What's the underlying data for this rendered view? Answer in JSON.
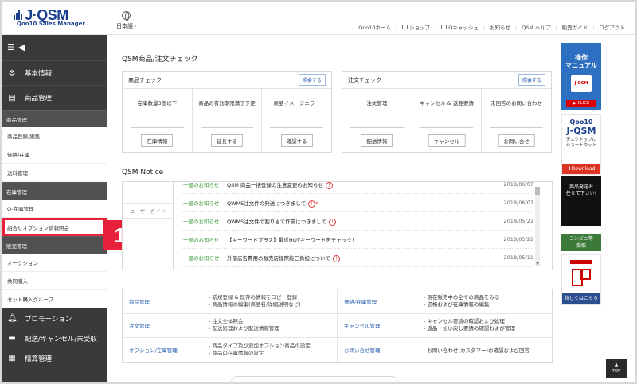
{
  "header": {
    "logo_text": "J·QSM",
    "logo_sub": "Qoo10 Sales Manager",
    "language": "日本語",
    "links": [
      "Qoo10ホーム",
      "ショップ",
      "Qキャッシュ",
      "お知らせ",
      "QSM ヘルプ",
      "販売ガイド",
      "ログアウト"
    ]
  },
  "sidebar": {
    "toggle": "☰ ◀",
    "top_items": [
      {
        "label": "基本情報",
        "icon": "gear-icon"
      },
      {
        "label": "商品管理",
        "icon": "document-icon"
      }
    ],
    "group1": "商品管理",
    "group1_items": [
      "商品登録/編集",
      "価格/在庫",
      "送料管理"
    ],
    "group2": "在庫管理",
    "group2_items": [
      "Q-在庫管理",
      "組合せオプション情報照会"
    ],
    "group3": "販売管理",
    "group3_items": [
      "オークション",
      "共同購入",
      "セット購入グループ"
    ],
    "bottom_items": [
      {
        "label": "プロモーション",
        "icon": "bell-icon"
      },
      {
        "label": "配送/キャンセル/未受取",
        "icon": "truck-icon"
      },
      {
        "label": "精算管理",
        "icon": "calculator-icon"
      }
    ]
  },
  "callout": "1",
  "main": {
    "title": "QSM商品/注文チェック",
    "product_check": {
      "title": "商品チェック",
      "reset": "照会する",
      "cols": [
        {
          "label": "在庫数量3個以下",
          "action": "在庫情報"
        },
        {
          "label": "商品の有効期限満了予定",
          "action": "延長する"
        },
        {
          "label": "商品イメージエラー",
          "action": "確認する"
        }
      ]
    },
    "order_check": {
      "title": "注文チェック",
      "reset": "照会する",
      "cols": [
        {
          "label": "注文管理",
          "action": "配送情報"
        },
        {
          "label": "キャンセル & 返品要請",
          "action": "キャンセル"
        },
        {
          "label": "未回答のお問い合わせ",
          "action": "お問い合せ"
        }
      ]
    },
    "notice_title": "QSM Notice",
    "notice_tab": "ユーザーガイド",
    "notices": [
      {
        "cat": "一般のお知らせ",
        "title": "QSM 商品一括登録の注意変更のお知らせ",
        "date": "2018/06/07",
        "flag": true
      },
      {
        "cat": "一般のお知らせ",
        "title": "QWMS注文件の発送につきまして",
        "date": "2018/06/07",
        "flag": true
      },
      {
        "cat": "一般のお知らせ",
        "title": "QWMS注文件の割り当て作業につきまして",
        "date": "2018/05/21",
        "flag": true
      },
      {
        "cat": "一般のお知らせ",
        "title": "【キーワードプラス】最近HOTキーワードをチェック！",
        "date": "2018/05/21",
        "flag": false
      },
      {
        "cat": "一般のお知らせ",
        "title": "外部広告費用の販売店様際能ご負担について",
        "date": "2018/05/11",
        "flag": true
      }
    ],
    "guide": [
      {
        "link": "商品管理",
        "desc": "- 新規登録 & 既存の情報をコピー登録\n- 商品情報の編集(商品名/詳細説明など)"
      },
      {
        "link": "価格/在庫管理",
        "desc": "- 現在販売中の全ての商品をみる\n- 価格および在庫情報の編集"
      },
      {
        "link": "注文管理",
        "desc": "- 注文全体照会\n- 配送処理および配送情報管理"
      },
      {
        "link": "キャンセル管理",
        "desc": "- キャンセル要請の確認および処理\n- 返品・払い戻し要請の確認および管理"
      },
      {
        "link": "オプション/在庫管理",
        "desc": "- 商品タイプ及び追加オプション商品の設定\n- 商品の在庫情報の設定"
      },
      {
        "link": "お問い合せ管理",
        "desc": "- お問い合わせ(カスタマー)の確認および回答"
      }
    ]
  },
  "banners": {
    "manual_title": "操作\nマニュアル",
    "manual_badge": "J-QSM",
    "manual_click": "▶ CLICK",
    "shortcut_q": "Qoo10",
    "shortcut_big": "J-QSM",
    "shortcut_text": "デスクトップに\nショートカット",
    "shortcut_dl": "⬇Download",
    "ad_text": "商品発送お\n任せて下さい!",
    "conv_text": "コンビニ等\n受取",
    "store_detail": "詳しくはこちら"
  },
  "top_button": "TOP"
}
